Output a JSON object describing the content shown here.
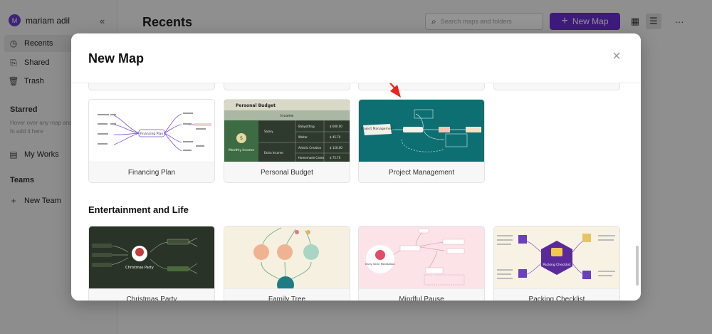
{
  "user": {
    "initial": "M",
    "name": "mariam adil"
  },
  "sidebar": {
    "nav": [
      {
        "label": "Recents",
        "icon": "clock-icon"
      },
      {
        "label": "Shared",
        "icon": "shared-icon"
      },
      {
        "label": "Trash",
        "icon": "trash-icon"
      }
    ],
    "starred_title": "Starred",
    "starred_hint": "Hover over any map and fo add it here",
    "my_works": "My Works",
    "teams_title": "Teams",
    "new_team": "New Team"
  },
  "main": {
    "title": "Recents",
    "search_placeholder": "Search maps and folders",
    "new_map_label": "New Map"
  },
  "modal": {
    "title": "New Map",
    "section_entertainment": "Entertainment and Life",
    "templates_row1": [
      {
        "label": "Financing Plan",
        "center": "Financing Plan"
      },
      {
        "label": "Personal Budget",
        "heading": "Personal Budget",
        "subheading": "Income",
        "rows": [
          {
            "group": "Salary",
            "name": "Babysitting",
            "value": "$ 600.00"
          },
          {
            "group": "Salary",
            "name": "Waiter",
            "value": "$ 45.70"
          },
          {
            "group": "Extra Income",
            "name": "Artistic Creation",
            "value": "$ 120.00"
          },
          {
            "group": "Extra Income",
            "name": "Homemade Cakes",
            "value": "$ 75.70"
          }
        ],
        "side": "Monthly Income"
      },
      {
        "label": "Project Management",
        "center": "Project Management"
      }
    ],
    "templates_row2": [
      {
        "label": "Christmas Party",
        "center": "Christmas Party"
      },
      {
        "label": "Family Tree"
      },
      {
        "label": "Mindful Pause",
        "center": "Early Seen Meditation"
      },
      {
        "label": "Packing Checklist",
        "center": "Packing Checklist"
      }
    ]
  },
  "colors": {
    "accent": "#6a2fd6",
    "teal": "#0e6f73",
    "budget_dark": "#2f3b2f",
    "christmas": "#2a3327",
    "arrow": "#e8231e"
  }
}
